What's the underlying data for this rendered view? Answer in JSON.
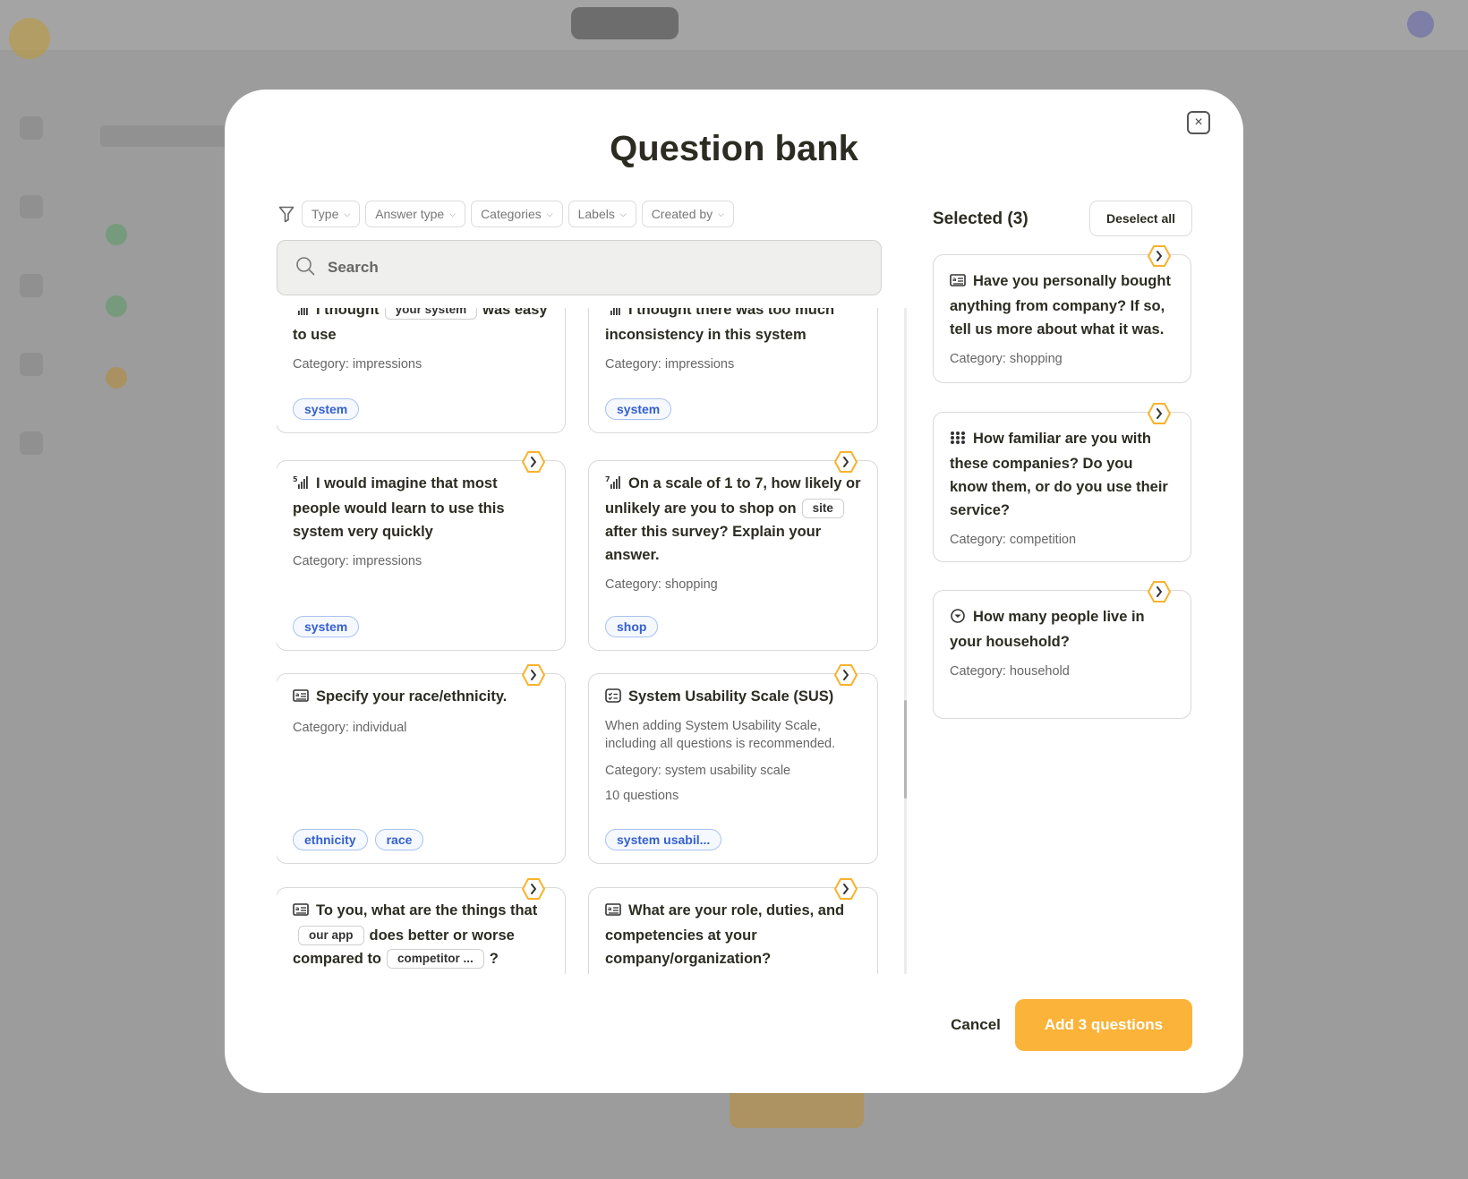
{
  "modal": {
    "title": "Question bank",
    "close_glyph": "×"
  },
  "filters": [
    {
      "label": "Type"
    },
    {
      "label": "Answer type"
    },
    {
      "label": "Categories"
    },
    {
      "label": "Labels"
    },
    {
      "label": "Created by"
    }
  ],
  "search": {
    "placeholder": "Search"
  },
  "questions": [
    {
      "icon": "rating-scale-5-icon",
      "parts": [
        "I thought",
        "your system",
        "was easy to use"
      ],
      "category": "Category: impressions",
      "tags": [
        "system"
      ]
    },
    {
      "icon": "rating-scale-5-icon",
      "text": "I thought there was too much inconsistency in this system",
      "category": "Category: impressions",
      "tags": [
        "system"
      ]
    },
    {
      "icon": "rating-scale-5-icon",
      "text": "I would imagine that most people would learn to use this system very quickly",
      "category": "Category: impressions",
      "tags": [
        "system"
      ]
    },
    {
      "icon": "rating-scale-7-icon",
      "parts": [
        "On a scale of 1 to 7, how likely or unlikely are you to shop on",
        "site",
        "after this survey? Explain your answer."
      ],
      "category": "Category: shopping",
      "tags": [
        "shop"
      ]
    },
    {
      "icon": "open-text-icon",
      "text": "Specify your race/ethnicity.",
      "category": "Category: individual",
      "tags": [
        "ethnicity",
        "race"
      ]
    },
    {
      "icon": "checklist-icon",
      "text": "System Usability Scale (SUS)",
      "description": "When adding System Usability Scale, including all questions is recommended.",
      "category": "Category: system usability scale",
      "count": "10 questions",
      "tags": [
        "system usabil..."
      ]
    },
    {
      "icon": "open-text-icon",
      "parts": [
        "To you, what are the things that",
        "our app",
        "does better or worse compared to",
        "competitor ...",
        "?"
      ]
    },
    {
      "icon": "open-text-icon",
      "text": "What are your role, duties, and competencies at your company/organization?"
    }
  ],
  "selected": {
    "title": "Selected (3)",
    "deselect_label": "Deselect all",
    "items": [
      {
        "icon": "open-text-icon",
        "text": "Have you personally bought anything from company? If so, tell us more about what it was.",
        "category": "Category: shopping"
      },
      {
        "icon": "matrix-grid-icon",
        "text": "How familiar are you with these companies? Do you know them, or do you use their service?",
        "category": "Category: competition"
      },
      {
        "icon": "dropdown-icon",
        "text": "How many people live in your household?",
        "category": "Category: household"
      }
    ]
  },
  "footer": {
    "cancel_label": "Cancel",
    "add_label": "Add 3 questions"
  },
  "colors": {
    "accent": "#FBB33A",
    "tag_text": "#3460CF",
    "tag_border": "#AAC2EF",
    "title_text": "#2C2C22"
  }
}
